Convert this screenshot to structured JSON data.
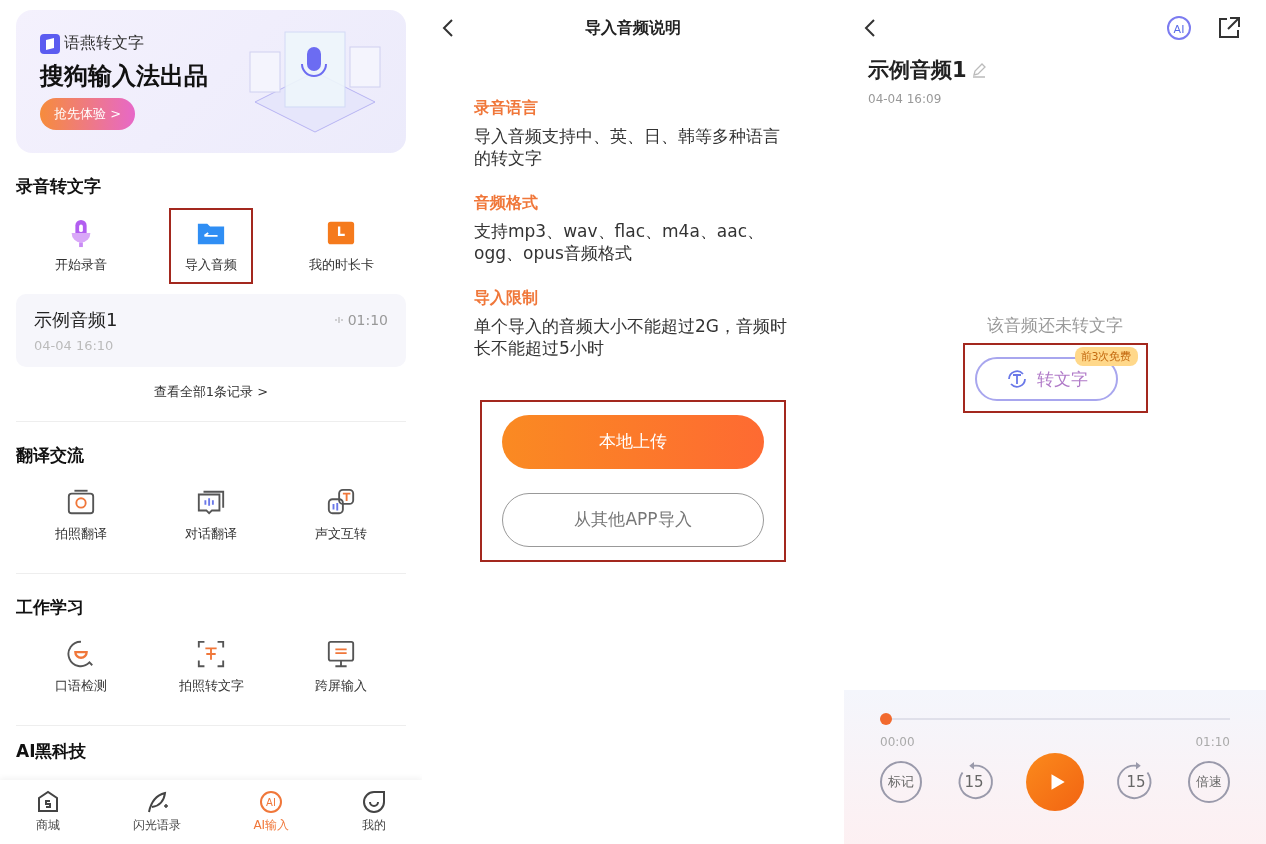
{
  "home": {
    "banner": {
      "brand": "语燕转文字",
      "headline": "搜狗输入法出品",
      "button": "抢先体验 >"
    },
    "record_section": {
      "title": "录音转文字",
      "tools": [
        {
          "label": "开始录音",
          "kind": "mic",
          "highlighted": false
        },
        {
          "label": "导入音频",
          "kind": "folder",
          "highlighted": true
        },
        {
          "label": "我的时长卡",
          "kind": "clock",
          "highlighted": false
        }
      ],
      "recent": {
        "title": "示例音频1",
        "date": "04-04 16:10",
        "duration": "01:10"
      },
      "view_all": "查看全部1条记录 >"
    },
    "sections": [
      {
        "title": "翻译交流",
        "tools": [
          {
            "label": "拍照翻译",
            "kind": "camera",
            "highlighted": false
          },
          {
            "label": "对话翻译",
            "kind": "chat",
            "highlighted": false
          },
          {
            "label": "声文互转",
            "kind": "swap",
            "highlighted": false
          }
        ]
      },
      {
        "title": "工作学习",
        "tools": [
          {
            "label": "口语检测",
            "kind": "speech",
            "highlighted": false
          },
          {
            "label": "拍照转文字",
            "kind": "scan",
            "highlighted": false
          },
          {
            "label": "跨屏输入",
            "kind": "monitor",
            "highlighted": false
          }
        ]
      }
    ],
    "more_heading": "AI黑科技",
    "tab_bar": [
      {
        "label": "商城",
        "kind": "shop",
        "selected": false
      },
      {
        "label": "闪光语录",
        "kind": "quill",
        "selected": false
      },
      {
        "label": "AI输入",
        "kind": "ai",
        "icon_text": "AI",
        "selected": true
      },
      {
        "label": "我的",
        "kind": "me",
        "selected": false
      }
    ]
  },
  "guide": {
    "title": "导入音频说明",
    "sections": [
      {
        "heading": "录音语言",
        "body": "导入音频支持中、英、日、韩等多种语言的转文字"
      },
      {
        "heading": "音频格式",
        "body": "支持mp3、wav、flac、m4a、aac、ogg、opus音频格式"
      },
      {
        "heading": "导入限制",
        "body": "单个导入的音频大小不能超过2G，音频时长不能超过5小时"
      }
    ],
    "buttons_highlighted": true,
    "buttons": [
      {
        "label": "本地上传",
        "kind": "primary"
      },
      {
        "label": "从其他APP导入",
        "kind": "outline"
      }
    ]
  },
  "detail": {
    "ai_badge": "AI",
    "title": "示例音频1",
    "date": "04-04 16:09",
    "empty_text": "该音频还未转文字",
    "transcribe": {
      "label": "转文字",
      "badge": "前3次免费",
      "highlighted": true
    },
    "player": {
      "level": 0,
      "elapsed": "00:00",
      "total": "01:10",
      "controls": [
        {
          "label": "标记",
          "kind": "text"
        },
        {
          "label": "15",
          "kind": "rewind"
        },
        {
          "kind": "play"
        },
        {
          "label": "15",
          "kind": "forward"
        },
        {
          "label": "倍速",
          "kind": "text"
        }
      ]
    }
  }
}
